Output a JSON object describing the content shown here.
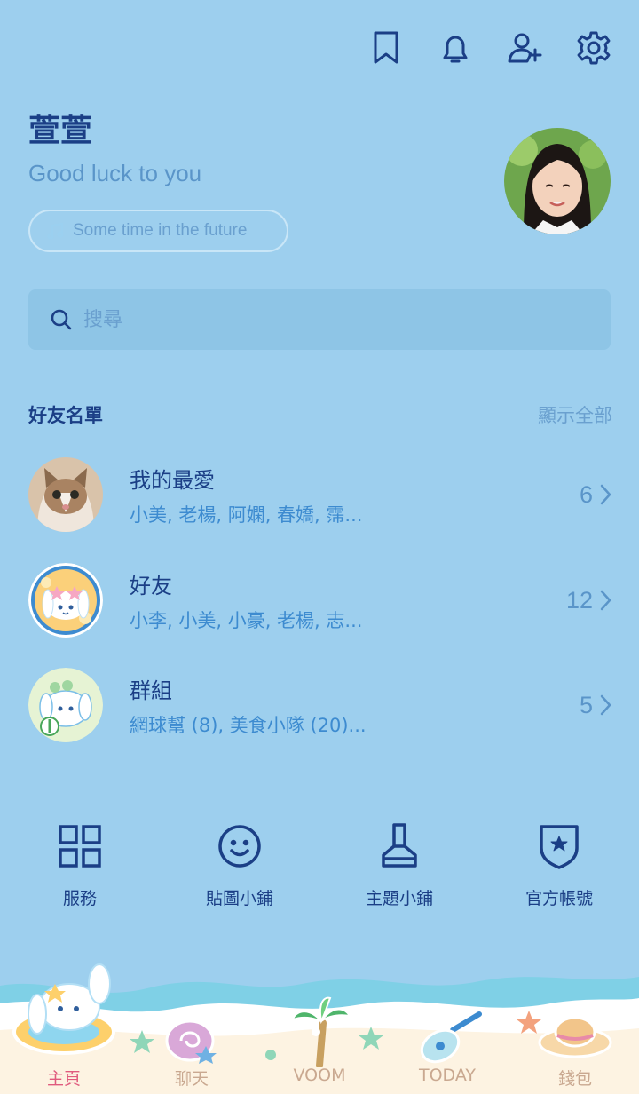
{
  "profile": {
    "name": "萱萱",
    "status_message": "Good luck to you",
    "music": "Some time in the future"
  },
  "search": {
    "placeholder": "搜尋"
  },
  "friends_section": {
    "title": "好友名單",
    "show_all": "顯示全部",
    "rows": [
      {
        "title": "我的最愛",
        "subtitle": "小美, 老楊, 阿嫻, 春嬌, 霈...",
        "count": "6"
      },
      {
        "title": "好友",
        "subtitle": "小李, 小美, 小豪, 老楊, 志...",
        "count": "12"
      },
      {
        "title": "群組",
        "subtitle": "網球幫 (8), 美食小隊 (20)...",
        "count": "5"
      }
    ]
  },
  "shortcuts": [
    {
      "label": "服務",
      "icon": "grid-icon"
    },
    {
      "label": "貼圖小鋪",
      "icon": "smiley-icon"
    },
    {
      "label": "主題小鋪",
      "icon": "brush-icon"
    },
    {
      "label": "官方帳號",
      "icon": "shield-star-icon"
    }
  ],
  "tabs": [
    {
      "label": "主頁",
      "active": true
    },
    {
      "label": "聊天",
      "active": false
    },
    {
      "label": "VOOM",
      "active": false
    },
    {
      "label": "TODAY",
      "active": false
    },
    {
      "label": "錢包",
      "active": false
    }
  ],
  "colors": {
    "background": "#9dcfee",
    "primary_text": "#1b3f86",
    "accent_pink": "#e05b7e"
  }
}
